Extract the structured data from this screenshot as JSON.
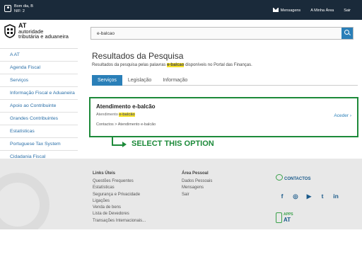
{
  "topbar": {
    "greeting": "Bom dia, B",
    "nif": "NIF: 2",
    "nav": [
      "Mensagens",
      "A Minha Área",
      "Sair"
    ]
  },
  "header": {
    "logo_line1": "AT",
    "logo_line2": "autoridade",
    "logo_line3": "tributária e aduaneira",
    "search_value": "e-balcao"
  },
  "sidebar": {
    "items": [
      {
        "label": "A AT"
      },
      {
        "label": "Agenda Fiscal"
      },
      {
        "label": "Serviços"
      },
      {
        "label": "Informação Fiscal e Aduaneira"
      },
      {
        "label": "Apoio ao Contribuinte"
      },
      {
        "label": "Grandes Contribuintes"
      },
      {
        "label": "Estatísticas"
      },
      {
        "label": "Portuguese Tax System"
      },
      {
        "label": "Cidadania Fiscal"
      }
    ]
  },
  "main": {
    "title": "Resultados da Pesquisa",
    "subtitle_before": "Resultados da pesquisa pelas palavras ",
    "subtitle_term": "e-balcao",
    "subtitle_after": " disponíveis no Portal das Finanças.",
    "tabs": [
      {
        "label": "Serviços",
        "active": true
      },
      {
        "label": "Legislação",
        "active": false
      },
      {
        "label": "Informação",
        "active": false
      }
    ]
  },
  "result": {
    "title": "Atendimento e-balcão",
    "meta_before": "Atendimento ",
    "meta_term": "e-balcão",
    "path": "Contactos > Atendimento e-balcão",
    "access_label": "Aceder ›"
  },
  "annotation": {
    "text": "SELECT THIS OPTION",
    "color": "#1d8a3a"
  },
  "footer": {
    "links_title": "Links Úteis",
    "links": [
      "Questões Frequentes",
      "Estatísticas",
      "Segurança e Privacidade",
      "Ligações",
      "Venda de bens",
      "Lista de Devedores",
      "Transações Internacionais..."
    ],
    "personal_title": "Área Pessoal",
    "personal": [
      "Dados Pessoais",
      "Mensagens",
      "Sair"
    ],
    "contactos": "CONTACTOS",
    "socials": [
      "f",
      "◎",
      "▶",
      "t",
      "in"
    ],
    "apps_label": "APPS",
    "apps_at": "AT"
  },
  "colors": {
    "topbar": "#1a2a3a",
    "accent": "#2a7fb8",
    "highlight": "#f5e12a",
    "annotation": "#1d8a3a"
  }
}
